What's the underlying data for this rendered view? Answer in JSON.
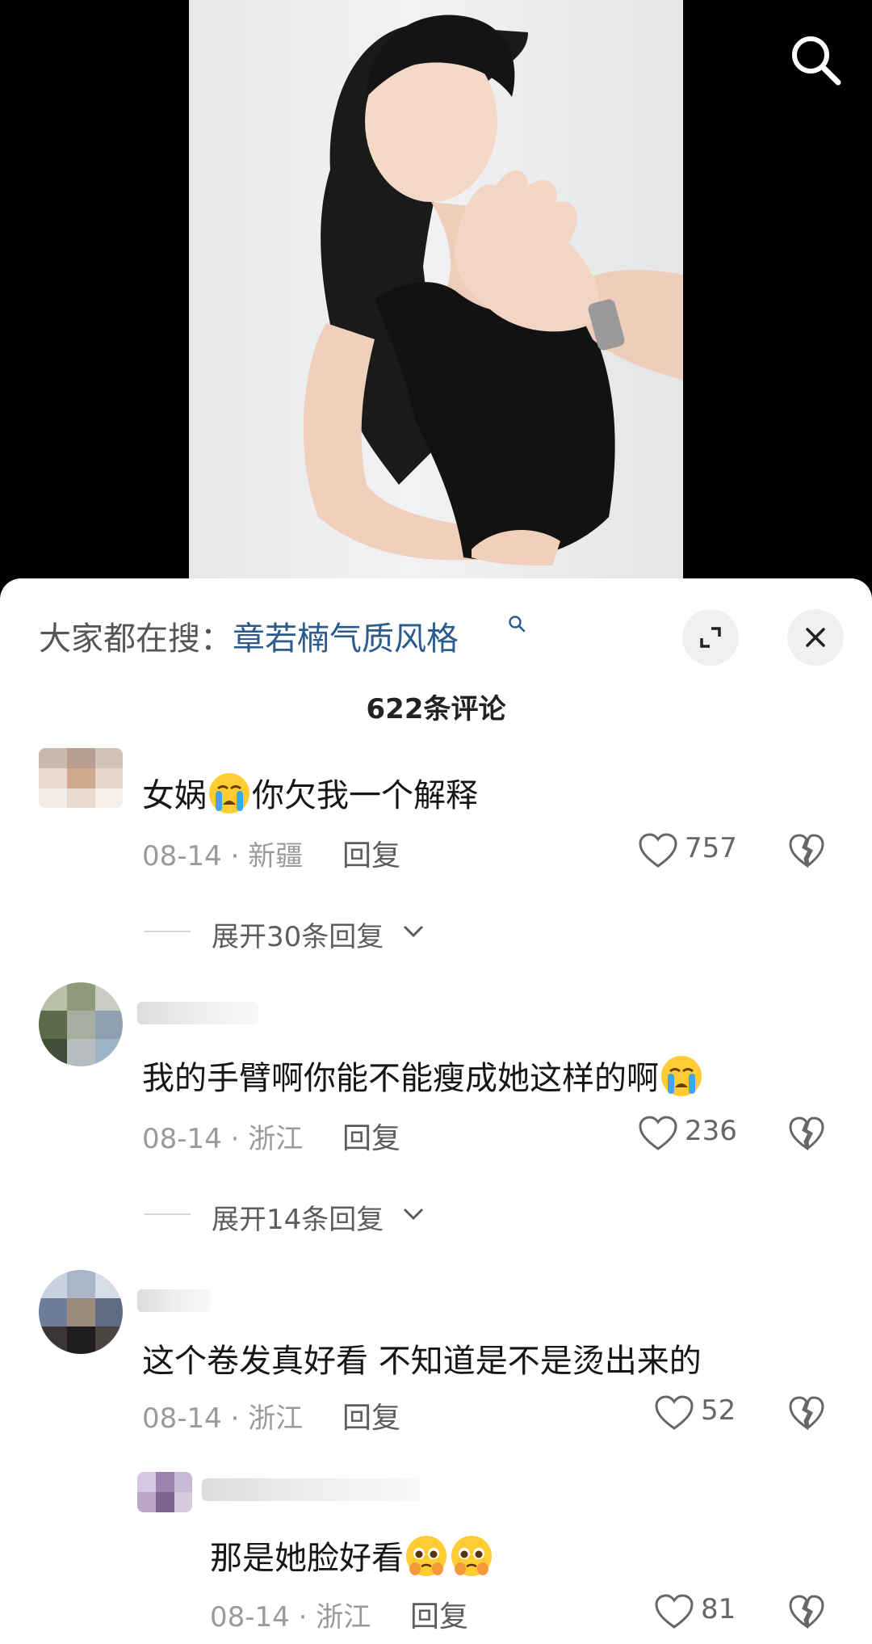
{
  "header": {
    "search_icon": "search-icon"
  },
  "hot_search": {
    "label": "大家都在搜：",
    "query": "章若楠气质风格",
    "query_icon": "magnifier-icon",
    "expand_icon": "expand-icon",
    "close_icon": "close-icon"
  },
  "comment_count": "622条评论",
  "comments": [
    {
      "text": "女娲",
      "text_after": "你欠我一个解释",
      "emoji": "crying-face-emoji",
      "meta": "08-14 · 新疆",
      "reply": "回复",
      "likes": "757",
      "expand": "展开30条回复"
    },
    {
      "text": "我的手臂啊你能不能瘦成她这样的啊",
      "emoji": "crying-face-emoji",
      "meta": "08-14 · 浙江",
      "reply": "回复",
      "likes": "236",
      "expand": "展开14条回复"
    },
    {
      "text": "这个卷发真好看 不知道是不是烫出来的",
      "meta": "08-14 · 浙江",
      "reply": "回复",
      "likes": "52"
    },
    {
      "text": "那是她脸好看",
      "emoji": "pleading-face-emoji",
      "meta": "08-14 · 浙江",
      "reply": "回复",
      "likes": "81"
    }
  ]
}
